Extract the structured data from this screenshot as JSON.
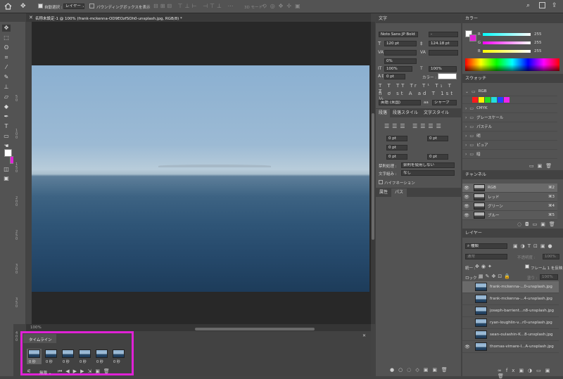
{
  "topbar": {
    "auto_select_label": "自動選択 :",
    "auto_select_value": "レイヤー",
    "bounding_box_label": "バウンディングボックスを表示",
    "mode_3d": "3D モード :"
  },
  "document_tab": {
    "title": "名称未設定-1 @ 100% (frank-mckenna-OD9EOzfSOh0-unsplash.jpg, RGB/8) *"
  },
  "ruler": {
    "left_labels": [
      "50",
      "100",
      "150",
      "200",
      "250",
      "300",
      "350",
      "400"
    ]
  },
  "status_bar": {
    "zoom": "100%"
  },
  "timeline": {
    "title": "タイムライン",
    "frames": [
      {
        "delay": "0 秒"
      },
      {
        "delay": "0 秒"
      },
      {
        "delay": "0 秒"
      },
      {
        "delay": "0 秒"
      },
      {
        "delay": "0 秒"
      },
      {
        "delay": "0 秒"
      }
    ],
    "loop": "無限"
  },
  "character_panel": {
    "title": "文字",
    "font_family": "Noto Sans JP Bold",
    "font_style": "-",
    "font_size": "120 pt",
    "leading": "124.18 pt",
    "tracking": "0%",
    "vertical_scale": "100%",
    "horizontal_scale": "100%",
    "baseline_shift": "0 pt",
    "color_label": "カラー :",
    "language": "英語 (米国)",
    "antialias_icon": "aa",
    "antialias": "シャープ"
  },
  "paragraph_panel": {
    "tabs": [
      "段落",
      "段落スタイル",
      "文字スタイル"
    ],
    "indent_left": "0 pt",
    "indent_right": "0 pt",
    "indent_first": "0 pt",
    "space_before": "0 pt",
    "space_after": "0 pt",
    "kinsoku_label": "禁則処理 :",
    "kinsoku_value": "禁則を使用しない",
    "mojikumi_label": "文字組み :",
    "mojikumi_value": "なし",
    "hyphenation": "ハイフネーション"
  },
  "props_panel": {
    "tabs": [
      "属性",
      "パス"
    ]
  },
  "color_panel": {
    "title": "カラー",
    "channels": [
      {
        "name": "R",
        "value": "255"
      },
      {
        "name": "G",
        "value": "255"
      },
      {
        "name": "B",
        "value": "255"
      }
    ],
    "foreground": "#ffffff",
    "background": "#e021d6"
  },
  "swatches_panel": {
    "title": "スウォッチ",
    "groups": [
      "RGB",
      "CMYK",
      "グレースケール",
      "パステル",
      "明",
      "ピュア",
      "暗"
    ],
    "rgb_colors": [
      "#ff1a1a",
      "#ffee00",
      "#22dd22",
      "#22dddd",
      "#2244ff",
      "#ee22ee"
    ]
  },
  "channels_panel": {
    "title": "チャンネル",
    "rows": [
      {
        "name": "RGB",
        "shortcut": "⌘2"
      },
      {
        "name": "レッド",
        "shortcut": "⌘3"
      },
      {
        "name": "グリーン",
        "shortcut": "⌘4"
      },
      {
        "name": "ブルー",
        "shortcut": "⌘5"
      }
    ]
  },
  "layers_panel": {
    "title": "レイヤー",
    "filter": "種類",
    "blend_mode": "通常",
    "opacity_label": "不透明度 :",
    "opacity": "100%",
    "unify_label": "統一 :",
    "propagate_frame": "フレーム 1 を反映",
    "lock_label": "ロック :",
    "fill_label": "塗り :",
    "fill": "100%",
    "layers": [
      {
        "name": "frank-mckenna-...0-unsplash.jpg",
        "visible": false
      },
      {
        "name": "frank-mckenna-...4-unsplash.jpg",
        "visible": false
      },
      {
        "name": "joseph-barrient...n8-unsplash.jpg",
        "visible": false
      },
      {
        "name": "ryan-loughlin-v...r0-unsplash.jpg",
        "visible": false
      },
      {
        "name": "sean-oulashin-K...8-unsplash.jpg",
        "visible": false
      },
      {
        "name": "thomas-vimare-I...A-unsplash.jpg",
        "visible": true
      }
    ]
  }
}
